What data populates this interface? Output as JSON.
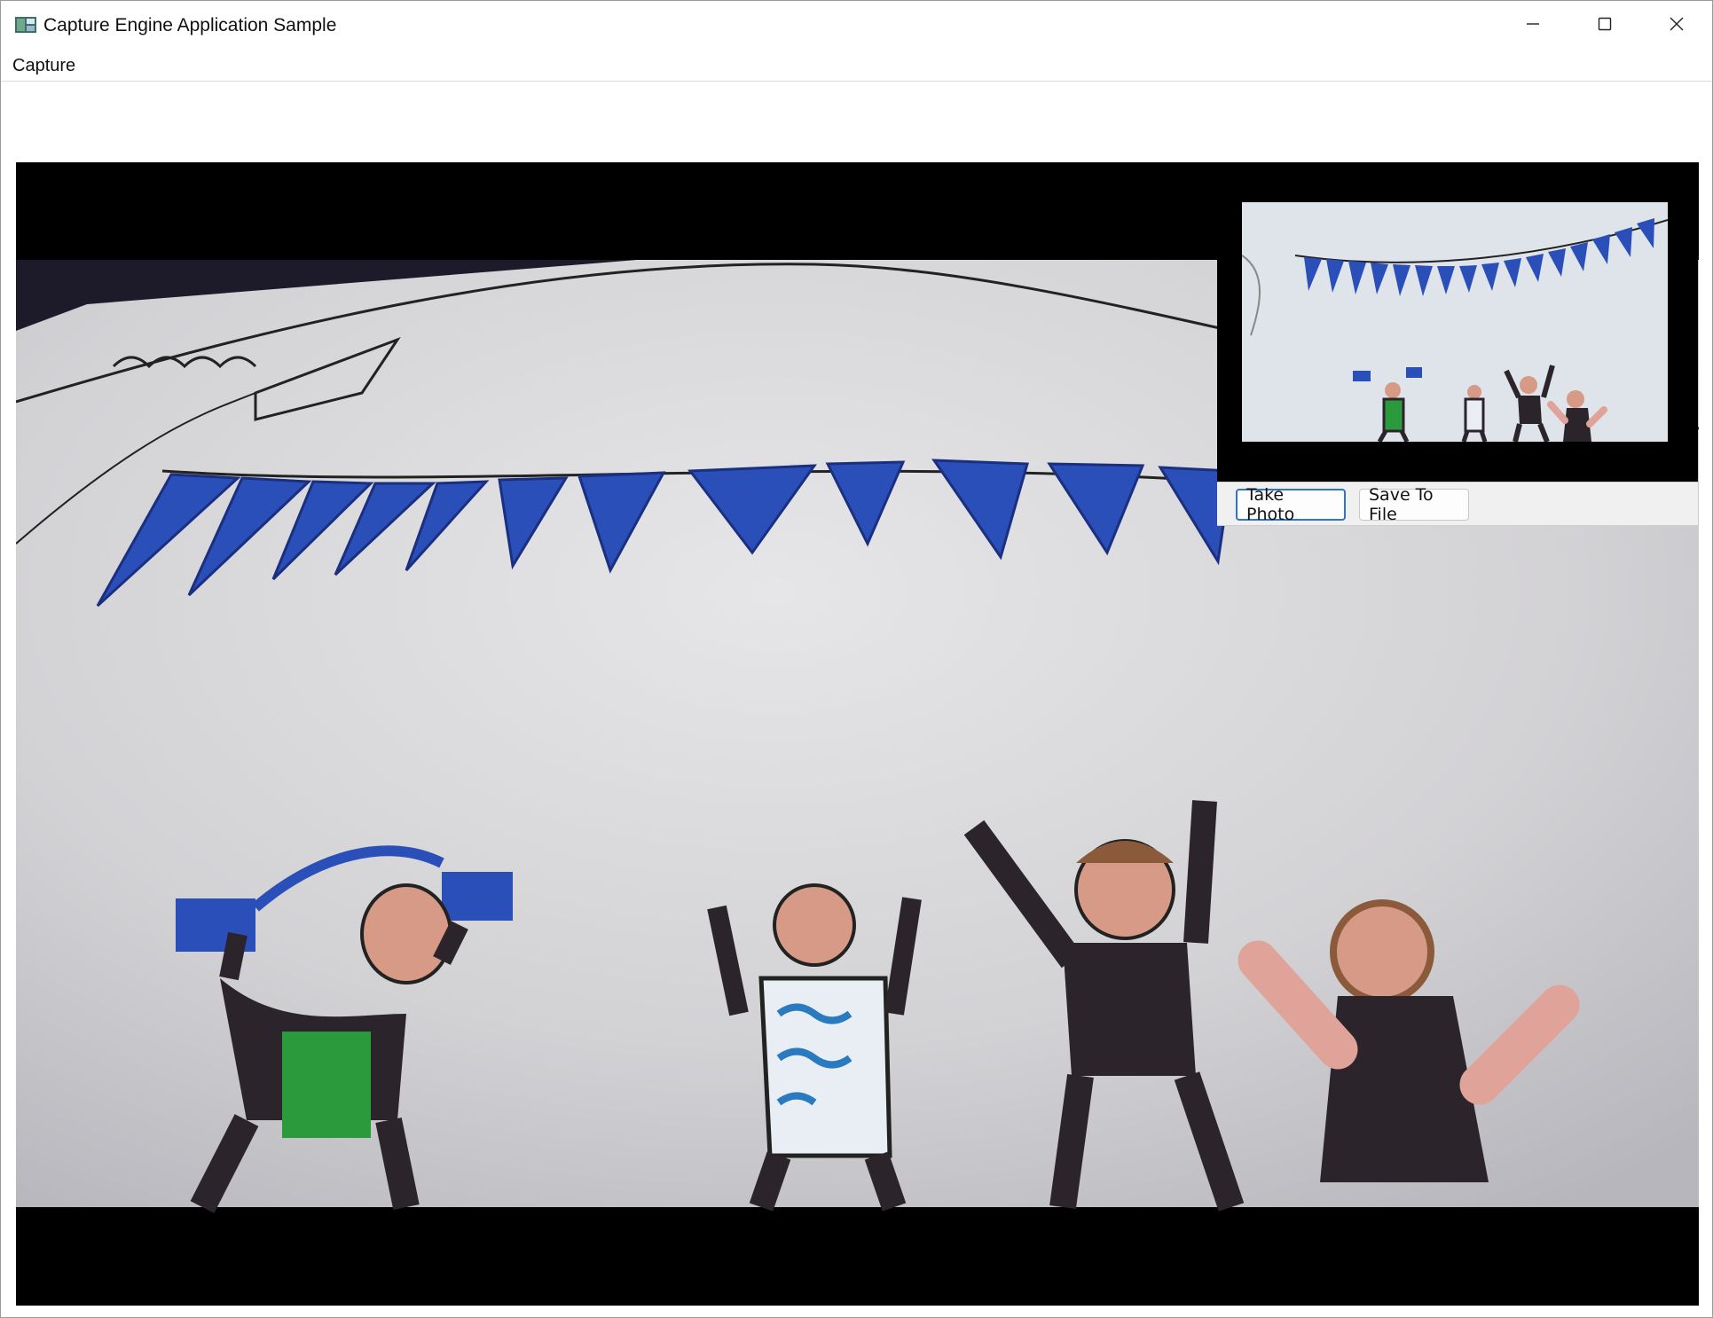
{
  "window": {
    "title": "Capture Engine Application Sample",
    "controls": {
      "minimize": "minimize-icon",
      "maximize": "maximize-icon",
      "close": "close-icon"
    }
  },
  "menu": {
    "items": [
      "Capture"
    ]
  },
  "preview": {
    "buttons": {
      "take_photo": "Take Photo",
      "save_to_file": "Save To File"
    }
  },
  "colors": {
    "accent": "#2f74c9",
    "video_bg": "#000000",
    "paper": "#d9d9dc",
    "bunting": "#2a4fb8"
  }
}
